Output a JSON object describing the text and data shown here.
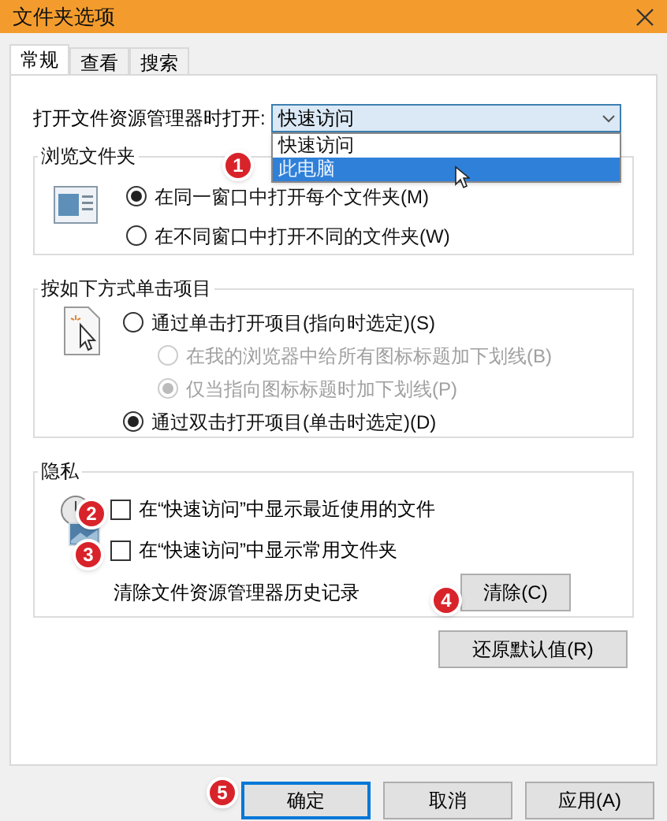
{
  "window": {
    "title": "文件夹选项"
  },
  "tabs": [
    {
      "label": "常规",
      "selected": true
    },
    {
      "label": "查看",
      "selected": false
    },
    {
      "label": "搜索",
      "selected": false
    }
  ],
  "open_in": {
    "label": "打开文件资源管理器时打开:",
    "value": "快速访问",
    "expanded": true,
    "options": [
      {
        "label": "快速访问",
        "highlighted": false
      },
      {
        "label": "此电脑",
        "highlighted": true
      }
    ]
  },
  "browse_folders": {
    "title": "浏览文件夹",
    "options": [
      {
        "label": "在同一窗口中打开每个文件夹(M)",
        "selected": true
      },
      {
        "label": "在不同窗口中打开不同的文件夹(W)",
        "selected": false
      }
    ]
  },
  "click_items": {
    "title": "按如下方式单击项目",
    "options": [
      {
        "label": "通过单击打开项目(指向时选定)(S)",
        "selected": false,
        "disabled": false,
        "children": [
          {
            "label": "在我的浏览器中给所有图标标题加下划线(B)",
            "selected": false,
            "disabled": true
          },
          {
            "label": "仅当指向图标标题时加下划线(P)",
            "selected": true,
            "disabled": true
          }
        ]
      },
      {
        "label": "通过双击打开项目(单击时选定)(D)",
        "selected": true,
        "disabled": false
      }
    ]
  },
  "privacy": {
    "title": "隐私",
    "checkboxes": [
      {
        "label": "在“快速访问”中显示最近使用的文件",
        "checked": false
      },
      {
        "label": "在“快速访问”中显示常用文件夹",
        "checked": false
      }
    ],
    "clear_label": "清除文件资源管理器历史记录",
    "clear_button": "清除(C)"
  },
  "restore_button": "还原默认值(R)",
  "buttons": [
    {
      "label": "确定",
      "focused": true
    },
    {
      "label": "取消",
      "focused": false
    },
    {
      "label": "应用(A)",
      "focused": false
    }
  ],
  "badges": [
    "1",
    "2",
    "3",
    "4",
    "5"
  ]
}
